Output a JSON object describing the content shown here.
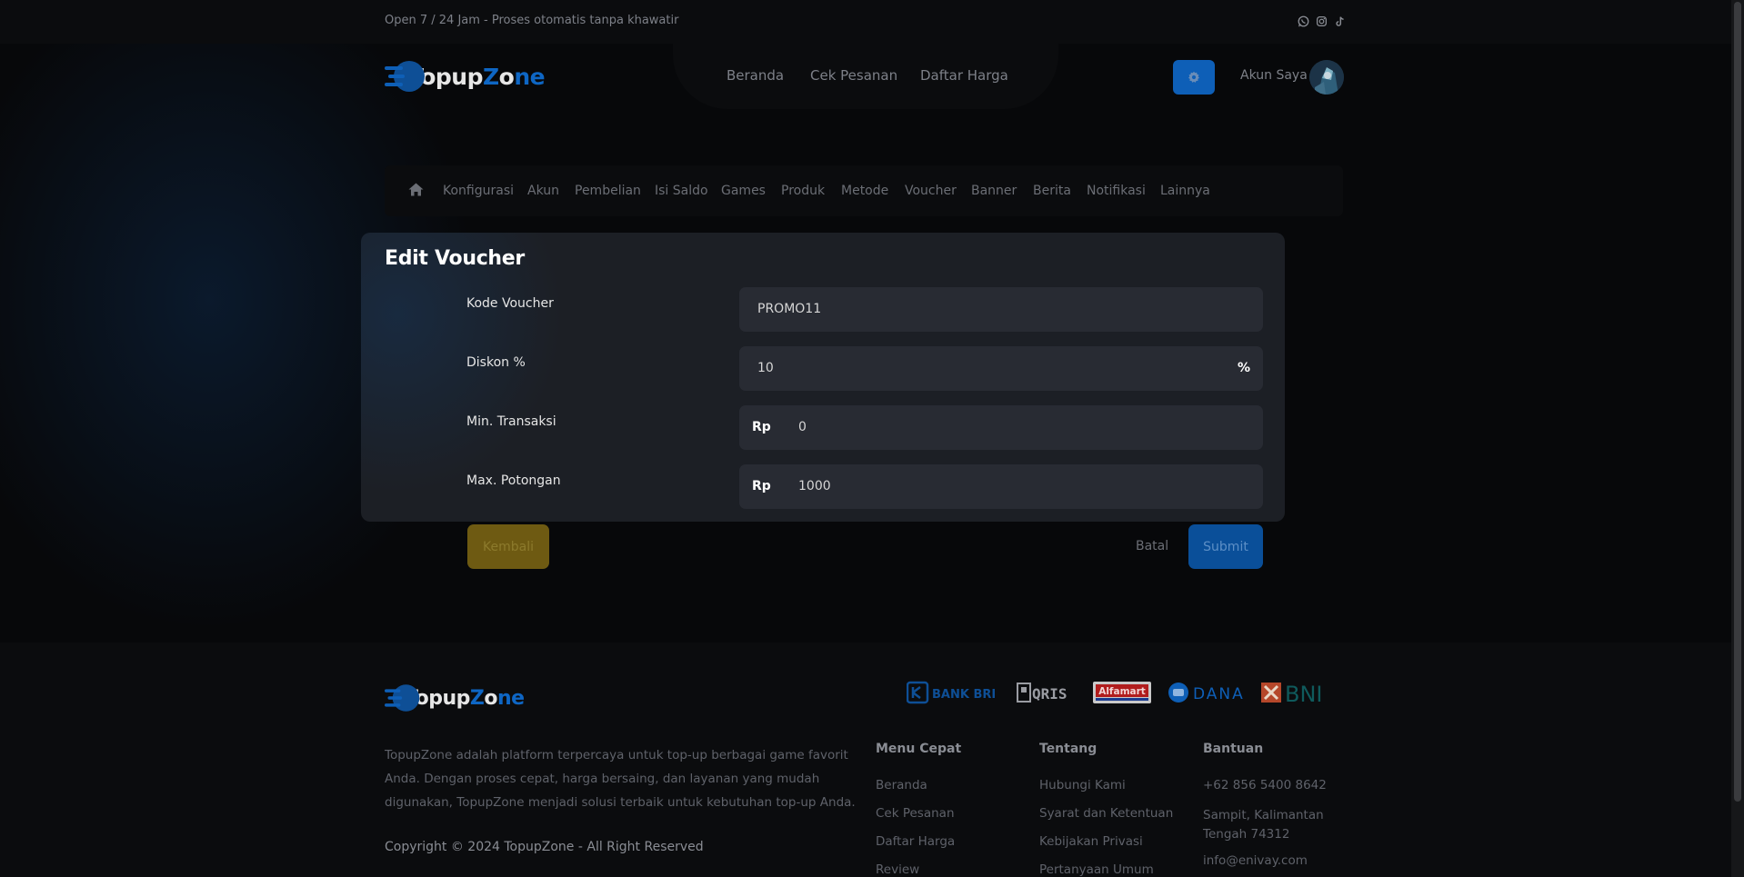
{
  "topbar": {
    "text": "Open 7 / 24 Jam - Proses otomatis tanpa khawatir",
    "socials": [
      "whatsapp-icon",
      "instagram-icon",
      "tiktok-icon"
    ]
  },
  "header": {
    "logo": {
      "part1": "Topup",
      "part2": "Z",
      "part3": "o",
      "part4": "ne"
    },
    "nav": [
      "Beranda",
      "Cek Pesanan",
      "Daftar Harga"
    ],
    "account_label": "Akun Saya",
    "settings_icon": "gear-icon"
  },
  "admin_menu": {
    "items": [
      "Konfigurasi",
      "Akun",
      "Pembelian",
      "Isi Saldo",
      "Games",
      "Produk",
      "Metode",
      "Voucher",
      "Banner",
      "Berita",
      "Notifikasi",
      "Lainnya"
    ]
  },
  "form": {
    "title": "Edit Voucher",
    "fields": [
      {
        "label": "Kode Voucher",
        "value": "PROMO11",
        "prefix": "",
        "suffix": ""
      },
      {
        "label": "Diskon %",
        "value": "10",
        "prefix": "",
        "suffix": "%"
      },
      {
        "label": "Min. Transaksi",
        "value": "0",
        "prefix": "Rp",
        "suffix": ""
      },
      {
        "label": "Max. Potongan",
        "value": "1000",
        "prefix": "Rp",
        "suffix": ""
      }
    ],
    "back_label": "Kembali",
    "cancel_label": "Batal",
    "submit_label": "Submit"
  },
  "footer": {
    "logo": {
      "part1": "Topup",
      "part2": "Z",
      "part3": "o",
      "part4": "ne"
    },
    "description": "TopupZone adalah platform terpercaya untuk top-up berbagai game favorit Anda. Dengan proses cepat, harga bersaing, dan layanan yang mudah digunakan, TopupZone menjadi solusi terbaik untuk kebutuhan top-up Anda.",
    "copyright": "Copyright © 2024 TopupZone - All Right Reserved",
    "payments": [
      "BANK BRI",
      "QRIS",
      "Alfamart",
      "DANA",
      "BNI"
    ],
    "columns": [
      {
        "title": "Menu Cepat",
        "links": [
          "Beranda",
          "Cek Pesanan",
          "Daftar Harga",
          "Review"
        ]
      },
      {
        "title": "Tentang",
        "links": [
          "Hubungi Kami",
          "Syarat dan Ketentuan",
          "Kebijakan Privasi",
          "Pertanyaan Umum"
        ]
      },
      {
        "title": "Bantuan",
        "links": [
          "+62 856 5400 8642",
          "Sampit, Kalimantan Tengah 74312",
          "info@enivay.com"
        ]
      }
    ]
  },
  "colors": {
    "accent": "#0e5fb7",
    "background": "#07080a",
    "card": "#1c1f25",
    "input": "#282b33",
    "back_button": "#6e5a12"
  }
}
